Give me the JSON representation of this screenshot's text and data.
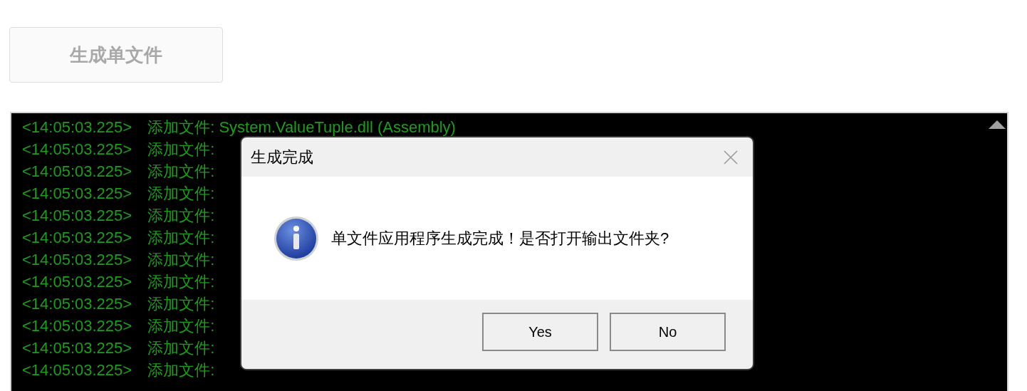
{
  "generate_button": {
    "label": "生成单文件",
    "disabled": true
  },
  "log": {
    "lines": [
      {
        "time": "<14:05:03.225>",
        "kind": "added_file",
        "message": "添加文件: System.ValueTuple.dll (Assembly)"
      },
      {
        "time": "<14:05:03.225>",
        "kind": "added_file",
        "message": "添加文件:"
      },
      {
        "time": "<14:05:03.225>",
        "kind": "added_file",
        "message": "添加文件:"
      },
      {
        "time": "<14:05:03.225>",
        "kind": "added_file",
        "message": "添加文件:"
      },
      {
        "time": "<14:05:03.225>",
        "kind": "added_file",
        "message": "添加文件:"
      },
      {
        "time": "<14:05:03.225>",
        "kind": "added_file",
        "message": "添加文件:"
      },
      {
        "time": "<14:05:03.225>",
        "kind": "added_file",
        "message": "添加文件:"
      },
      {
        "time": "<14:05:03.225>",
        "kind": "added_file",
        "message": "添加文件:"
      },
      {
        "time": "<14:05:03.225>",
        "kind": "added_file",
        "message": "添加文件:"
      },
      {
        "time": "<14:05:03.225>",
        "kind": "added_file",
        "message": "添加文件:"
      },
      {
        "time": "<14:05:03.225>",
        "kind": "added_file",
        "message": "添加文件:"
      },
      {
        "time": "<14:05:03.225>",
        "kind": "added_file",
        "message": "添加文件:"
      }
    ]
  },
  "dialog": {
    "title": "生成完成",
    "message": "单文件应用程序生成完成！是否打开输出文件夹?",
    "buttons": [
      "Yes",
      "No"
    ]
  }
}
